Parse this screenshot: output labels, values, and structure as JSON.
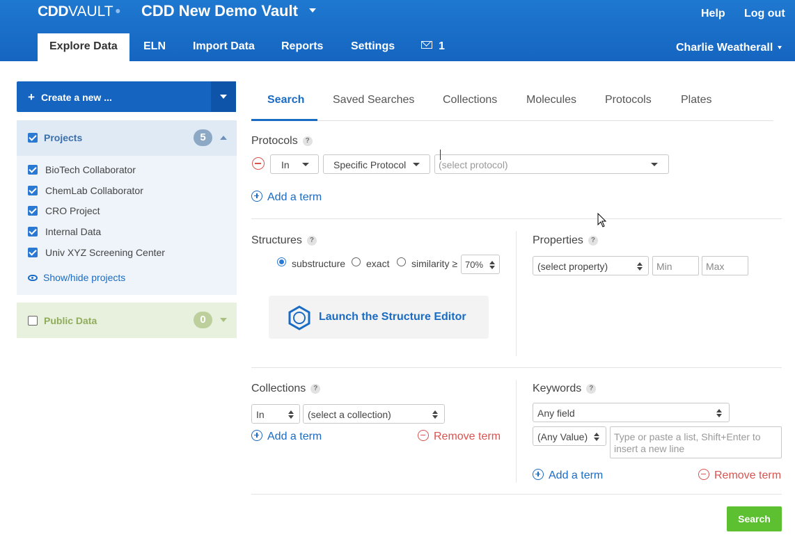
{
  "header": {
    "logo": {
      "brand": "CDD",
      "product": "VAULT",
      "dot": "•"
    },
    "vault_name": "CDD New Demo Vault",
    "help_label": "Help",
    "logout_label": "Log out",
    "user_name": "Charlie Weatherall",
    "nav": {
      "explore": "Explore Data",
      "eln": "ELN",
      "import": "Import Data",
      "reports": "Reports",
      "settings": "Settings",
      "messages_count": "1"
    }
  },
  "sidebar": {
    "create_label": "Create a new ...",
    "create_plus": "+",
    "projects": {
      "title": "Projects",
      "count": "5",
      "checked": true,
      "items": [
        {
          "label": "BioTech Collaborator",
          "checked": true
        },
        {
          "label": "ChemLab Collaborator",
          "checked": true
        },
        {
          "label": "CRO Project",
          "checked": true
        },
        {
          "label": "Internal Data",
          "checked": true
        },
        {
          "label": "Univ XYZ Screening Center",
          "checked": true
        }
      ],
      "show_hide_label": "Show/hide projects"
    },
    "public_data": {
      "title": "Public Data",
      "count": "0",
      "checked": false
    }
  },
  "main": {
    "tabs": {
      "search": "Search",
      "saved_searches": "Saved Searches",
      "collections": "Collections",
      "molecules": "Molecules",
      "protocols": "Protocols",
      "plates": "Plates"
    },
    "active_tab": "Search",
    "protocols": {
      "title": "Protocols",
      "help": "?",
      "operator": "In",
      "scope": "Specific Protocol",
      "protocol_placeholder": "(select protocol)",
      "add_term": "Add a term"
    },
    "structures": {
      "title": "Structures",
      "help": "?",
      "options": {
        "substructure": "substructure",
        "exact": "exact",
        "similarity": "similarity ≥"
      },
      "selected": "substructure",
      "similarity_value": "70%",
      "launch_label": "Launch the Structure Editor"
    },
    "properties": {
      "title": "Properties",
      "help": "?",
      "property_placeholder": "(select property)",
      "min_placeholder": "Min",
      "max_placeholder": "Max"
    },
    "collections": {
      "title": "Collections",
      "help": "?",
      "operator": "In",
      "collection_placeholder": "(select a collection)",
      "add_term": "Add a term",
      "remove_term": "Remove term"
    },
    "keywords": {
      "title": "Keywords",
      "help": "?",
      "field": "Any field",
      "value_mode": "(Any Value)",
      "text_placeholder": "Type or paste a list, Shift+Enter to insert a new line",
      "add_term": "Add a term",
      "remove_term": "Remove term"
    },
    "search_button": "Search"
  },
  "colors": {
    "header_blue": "#1565c0",
    "accent_blue": "#1a6bc4",
    "remove_red": "#d9534f",
    "search_green": "#5cc030"
  }
}
